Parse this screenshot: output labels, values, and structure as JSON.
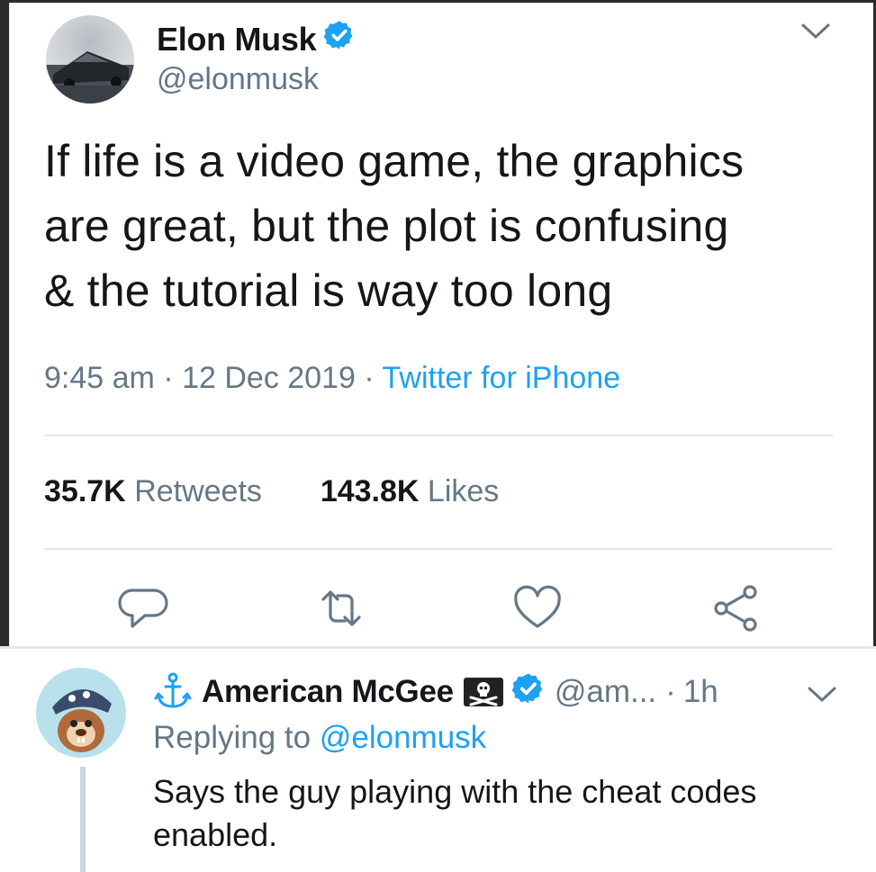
{
  "tweet": {
    "author_name": "Elon Musk",
    "author_handle": "@elonmusk",
    "text": "If life is a video game, the graphics\nare great, but the plot is confusing\n& the tutorial is way too long",
    "time": "9:45 am",
    "date": "12 Dec 2019",
    "separator": "·",
    "source": "Twitter for iPhone",
    "retweets_count": "35.7K",
    "retweets_label": "Retweets",
    "likes_count": "143.8K",
    "likes_label": "Likes",
    "actions": [
      {
        "icon": "reply-icon"
      },
      {
        "icon": "retweet-icon"
      },
      {
        "icon": "like-icon"
      },
      {
        "icon": "share-icon"
      }
    ]
  },
  "reply": {
    "author_name": "American McGee",
    "author_handle": "@am...",
    "separator": "·",
    "time": "1h",
    "replying_prefix": "Replying to",
    "replying_to": "@elonmusk",
    "text": "Says the guy playing with the cheat codes enabled."
  },
  "colors": {
    "accent": "#1da1f2",
    "secondary_text": "#657786",
    "primary_text": "#14171a",
    "divider": "#e1e8ed"
  }
}
